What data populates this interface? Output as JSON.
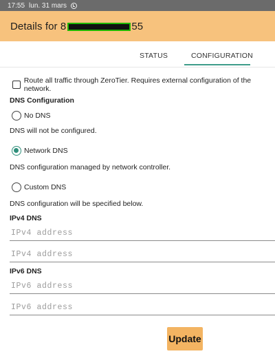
{
  "status_bar": {
    "time": "17:55",
    "date": "lun. 31 mars",
    "sync_icon": "sync-icon"
  },
  "app_bar": {
    "title_prefix": "Details for 8",
    "title_suffix": "55"
  },
  "tabs": [
    {
      "label": "STATUS"
    },
    {
      "label": "CONFIGURATION",
      "selected": true
    }
  ],
  "route_all": {
    "label": "Route all traffic through ZeroTier. Requires external configuration of the network.",
    "checked": false
  },
  "dns_config": {
    "heading": "DNS Configuration",
    "options": [
      {
        "label": "No DNS",
        "description": "DNS will not be configured.",
        "checked": false
      },
      {
        "label": "Network DNS",
        "description": "DNS configuration managed by network controller.",
        "checked": true
      },
      {
        "label": "Custom DNS",
        "description": "DNS configuration will be specified below.",
        "checked": false
      }
    ]
  },
  "ipv4": {
    "heading": "IPv4 DNS",
    "fields": [
      {
        "placeholder": "IPv4 address",
        "value": ""
      },
      {
        "placeholder": "IPv4 address",
        "value": ""
      }
    ]
  },
  "ipv6": {
    "heading": "IPv6 DNS",
    "fields": [
      {
        "placeholder": "IPv6 address",
        "value": ""
      },
      {
        "placeholder": "IPv6 address",
        "value": ""
      }
    ]
  },
  "update_button": {
    "label": "Update"
  },
  "colors": {
    "app_bar": "#f7c27d",
    "accent": "#2f8f7b",
    "button": "#f3b462"
  }
}
